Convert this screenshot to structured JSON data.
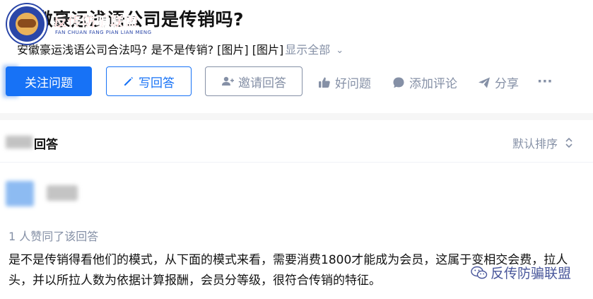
{
  "question": {
    "title": "安徽豪运浅语公司是传销吗?",
    "description": "安徽豪运浅语公司合法吗? 是不是传销? [图片] [图片]",
    "show_all": "显示全部"
  },
  "logo": {
    "name": "反传防骗联盟",
    "subtitle": "FAN CHUAN FANG PIAN LIAN MENG"
  },
  "buttons": {
    "follow": "关注问题",
    "write": "写回答",
    "invite": "邀请回答"
  },
  "actions": {
    "good_question": "好问题",
    "comment": "添加评论",
    "share": "分享",
    "more": "···"
  },
  "answers": {
    "count_label": "回答",
    "sort_label": "默认排序",
    "voters": "1 人赞同了该回答",
    "content": "是不是传销得看他们的模式，从下面的模式来看，需要消费1800才能成为会员，这属于变相交会费，拉人头，并以所拉人数为依据计算报酬，会员分等级，很符合传销的特征。"
  },
  "watermark": {
    "text": "反传防骗联盟",
    "icon": "wechat-icon"
  },
  "colors": {
    "primary": "#1772f6",
    "muted": "#8590a6",
    "text": "#121212",
    "background": "#f6f6f6"
  }
}
